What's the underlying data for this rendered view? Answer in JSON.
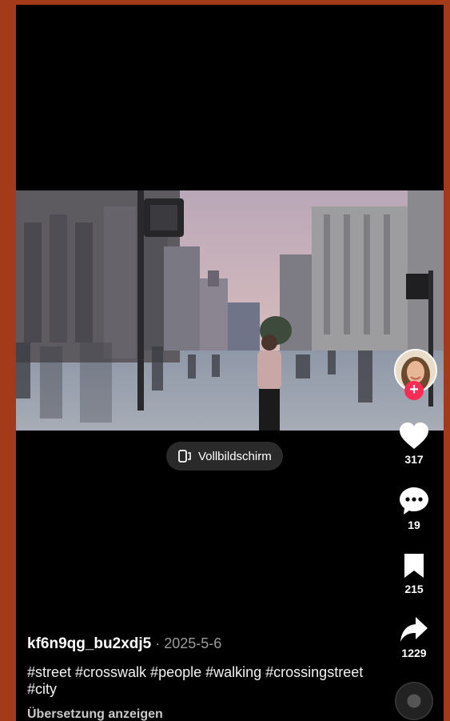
{
  "video": {
    "fullscreen_label": "Vollbildschirm"
  },
  "actions": {
    "likes": "317",
    "comments": "19",
    "saves": "215",
    "shares": "1229"
  },
  "post": {
    "username": "kf6n9qg_bu2xdj5",
    "separator": " · ",
    "date": "2025-5-6",
    "caption": "#street #crosswalk #people #walking #crossingstreet #city",
    "translate_label": "Übersetzung anzeigen"
  },
  "colors": {
    "accent": "#fe2c55",
    "frame": "#a33a1a",
    "background": "#000000"
  },
  "icons": [
    "fullscreen-icon",
    "heart-icon",
    "comment-icon",
    "bookmark-icon",
    "share-icon",
    "follow-plus-icon",
    "music-disc-icon"
  ]
}
